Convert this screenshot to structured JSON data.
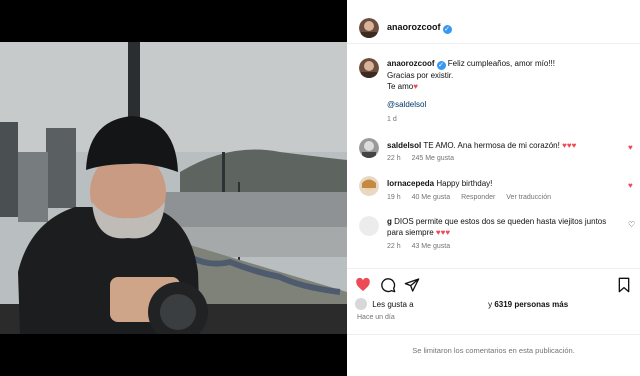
{
  "post": {
    "author": "anaorozcoof",
    "caption": {
      "line1": "Feliz cumpleaños, amor mío!!!",
      "line2": "Gracias por existir.",
      "line3": "Te amo",
      "mention": "@saldelsol",
      "age": "1 d"
    }
  },
  "comments": [
    {
      "user": "saldelsol",
      "text": "TE AMO. Ana hermosa de mi corazón!",
      "hearts": "♥♥♥",
      "time": "22 h",
      "likes": "245 Me gusta",
      "reply": "",
      "translate": ""
    },
    {
      "user": "lornacepeda",
      "text": "Happy birthday!",
      "hearts": "",
      "time": "19 h",
      "likes": "40 Me gusta",
      "reply": "Responder",
      "translate": "Ver traducción"
    },
    {
      "user": "g",
      "text": "DIOS permite que estos dos se queden hasta viejitos juntos para siempre",
      "hearts": "♥♥♥",
      "time": "22 h",
      "likes": "43 Me gusta",
      "reply": "",
      "translate": ""
    }
  ],
  "likes": {
    "prefix": "Les gusta a",
    "names": "y",
    "count": "6319 personas más"
  },
  "since": "Hace un día",
  "limited_notice": "Se limitaron los comentarios en esta publicación.",
  "colors": {
    "like_red": "#ed4956",
    "verified_blue": "#3897f0",
    "link_blue": "#00376b"
  },
  "icons": [
    "more-options-icon",
    "heart-icon",
    "comment-icon",
    "share-icon",
    "save-icon",
    "verified-icon"
  ]
}
